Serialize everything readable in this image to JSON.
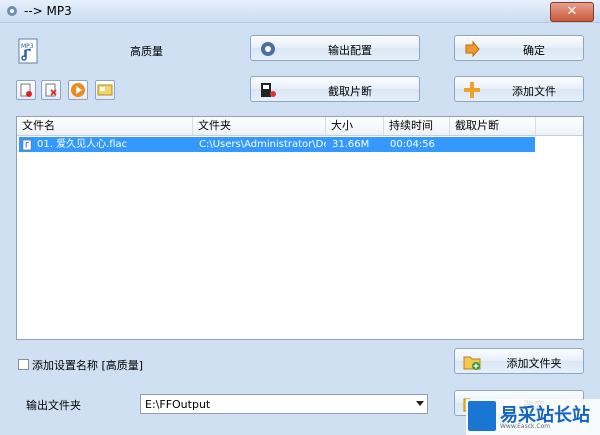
{
  "window": {
    "title": "--> MP3"
  },
  "preset": {
    "label": "高质量"
  },
  "buttons": {
    "output_config": "输出配置",
    "confirm": "确定",
    "clip": "截取片断",
    "add_file": "添加文件",
    "add_folder": "添加文件夹",
    "partial_bottom": "改变"
  },
  "table": {
    "headers": [
      "文件名",
      "文件夹",
      "大小",
      "持续时间",
      "截取片断"
    ],
    "rows": [
      [
        "01. 爱久见人心.flac",
        "C:\\Users\\Administrator\\Des...",
        "31.66M",
        "00:04:56",
        ""
      ]
    ]
  },
  "options": {
    "add_setting_name": "添加设置名称 [高质量]",
    "checked": false
  },
  "output": {
    "label": "输出文件夹",
    "value": "E:\\FFOutput"
  },
  "watermark": {
    "text": "易采站长站",
    "sub": "Www.Easck.Com"
  },
  "colors": {
    "selection": "#3399ff",
    "window_bg": "#cfe0f3",
    "close": "#c75a3a"
  }
}
